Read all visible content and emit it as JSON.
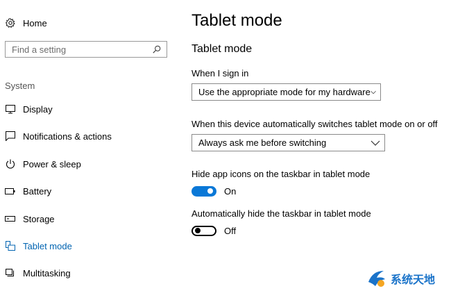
{
  "sidebar": {
    "home_label": "Home",
    "search_placeholder": "Find a setting",
    "section_label": "System",
    "items": [
      {
        "label": "Display",
        "icon": "monitor-icon"
      },
      {
        "label": "Notifications & actions",
        "icon": "notifications-icon"
      },
      {
        "label": "Power & sleep",
        "icon": "power-icon"
      },
      {
        "label": "Battery",
        "icon": "battery-icon"
      },
      {
        "label": "Storage",
        "icon": "storage-icon"
      },
      {
        "label": "Tablet mode",
        "icon": "tablet-mode-icon",
        "active": true
      },
      {
        "label": "Multitasking",
        "icon": "multitasking-icon"
      }
    ]
  },
  "main": {
    "title": "Tablet mode",
    "subtitle": "Tablet mode",
    "sign_in": {
      "label": "When I sign in",
      "value": "Use the appropriate mode for my hardware"
    },
    "auto_switch": {
      "label": "When this device automatically switches tablet mode on or off",
      "value": "Always ask me before switching"
    },
    "hide_icons": {
      "label": "Hide app icons on the taskbar in tablet mode",
      "state": "On",
      "on": true
    },
    "hide_taskbar": {
      "label": "Automatically hide the taskbar in tablet mode",
      "state": "Off",
      "on": false
    }
  },
  "watermark": {
    "text": "系统天地"
  },
  "colors": {
    "accent": "#0a78d7",
    "active_nav": "#0063b1"
  }
}
